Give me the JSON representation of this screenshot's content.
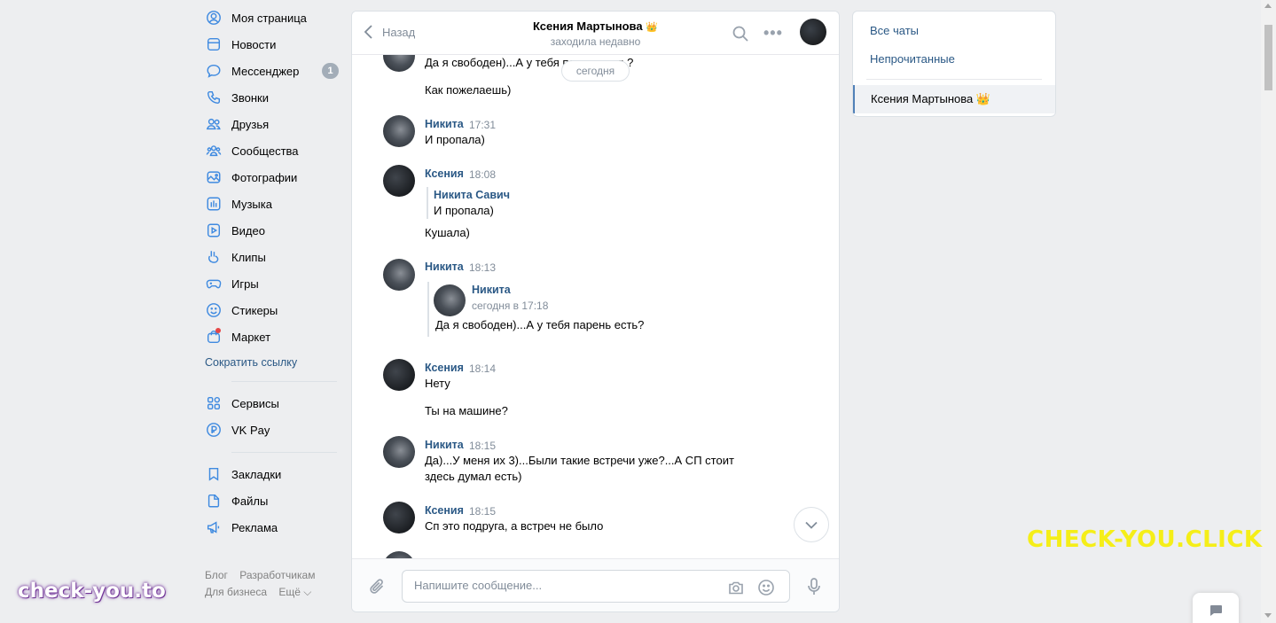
{
  "nav": {
    "items": [
      {
        "label": "Моя страница",
        "icon": "user-circle-icon"
      },
      {
        "label": "Новости",
        "icon": "news-icon"
      },
      {
        "label": "Мессенджер",
        "icon": "message-icon",
        "badge": "1"
      },
      {
        "label": "Звонки",
        "icon": "phone-icon"
      },
      {
        "label": "Друзья",
        "icon": "friends-icon"
      },
      {
        "label": "Сообщества",
        "icon": "communities-icon"
      },
      {
        "label": "Фотографии",
        "icon": "photo-icon"
      },
      {
        "label": "Музыка",
        "icon": "music-icon"
      },
      {
        "label": "Видео",
        "icon": "video-icon"
      },
      {
        "label": "Клипы",
        "icon": "clips-icon"
      },
      {
        "label": "Игры",
        "icon": "gamepad-icon"
      },
      {
        "label": "Стикеры",
        "icon": "sticker-icon"
      },
      {
        "label": "Маркет",
        "icon": "market-icon"
      }
    ],
    "short_link": "Сократить ссылку",
    "group2": [
      {
        "label": "Сервисы",
        "icon": "services-icon"
      },
      {
        "label": "VK Pay",
        "icon": "vkpay-icon"
      }
    ],
    "group3": [
      {
        "label": "Закладки",
        "icon": "bookmark-icon"
      },
      {
        "label": "Файлы",
        "icon": "file-icon"
      },
      {
        "label": "Реклама",
        "icon": "ads-icon"
      }
    ],
    "footer": [
      "Блог",
      "Разработчикам",
      "Для бизнеса",
      "Ещё ⌵"
    ]
  },
  "chat": {
    "back_label": "Назад",
    "title": "Ксения Мартынова",
    "title_emoji": "👑",
    "status": "заходила недавно",
    "date_pill": "сегодня",
    "input_placeholder": "Напишите сообщение...",
    "top_partial": [
      "Да я свободен)...А у тебя парень есть?",
      "Как пожелаешь)"
    ],
    "messages": [
      {
        "author": "Никита",
        "time": "17:31",
        "text": "И пропала)"
      },
      {
        "author": "Ксения",
        "time": "18:08",
        "quote_author": "Никита Савич",
        "quote_text": "И пропала)",
        "text": "Кушала)"
      },
      {
        "author": "Никита",
        "time": "18:13",
        "fwd_author": "Никита",
        "fwd_time": "сегодня в 17:18",
        "fwd_text": "Да я свободен)...А у тебя парень есть?"
      },
      {
        "author": "Ксения",
        "time": "18:14",
        "text": "Нету",
        "text2": "Ты на машине?"
      },
      {
        "author": "Никита",
        "time": "18:15",
        "text": "Да)...У меня их 3)...Были такие встречи уже?...А СП стоит здесь думал есть)"
      },
      {
        "author": "Ксения",
        "time": "18:15",
        "text": "Сп это подруга, а встреч не было"
      }
    ]
  },
  "filters": {
    "all": "Все чаты",
    "unread": "Непрочитанные",
    "active_chat": "Ксения Мартынова 👑"
  },
  "watermarks": {
    "right": "CHECK-YOU.CLICK",
    "left": "check-you.to"
  },
  "colors": {
    "accent": "#3f8ae0",
    "link": "#2a5885",
    "background": "#edeef0",
    "watermark_yellow": "#f5ee18"
  }
}
